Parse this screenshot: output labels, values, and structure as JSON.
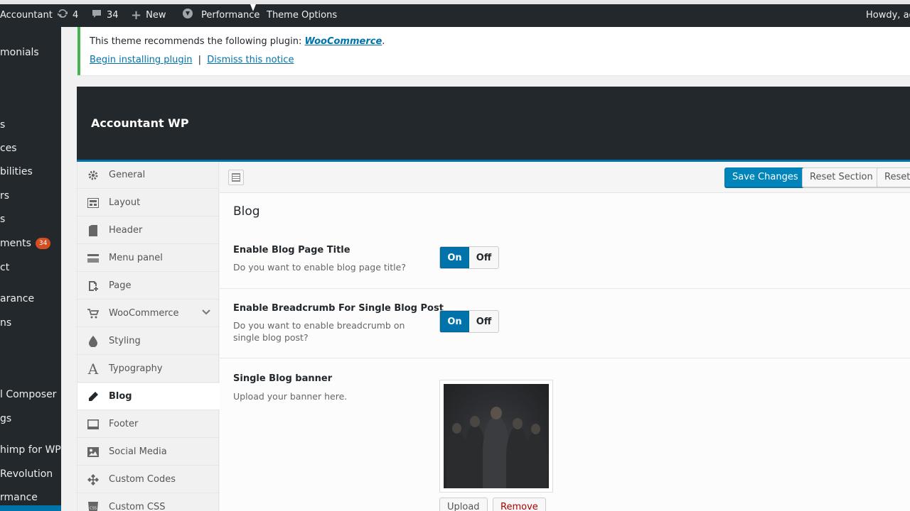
{
  "admin_bar": {
    "site_name": "Accountant",
    "updates_count": "4",
    "comments_count": "34",
    "new_label": "New",
    "performance_label": "Performance",
    "theme_options_label": "Theme Options",
    "howdy_label": "Howdy, ad"
  },
  "admin_menu": {
    "items": [
      {
        "label": "monials"
      },
      {
        "label": "s"
      },
      {
        "label": "ces"
      },
      {
        "label": "bilities"
      },
      {
        "label": "rs"
      },
      {
        "label": "s"
      },
      {
        "label": "ments",
        "badge": "34"
      },
      {
        "label": "ct"
      },
      {
        "label": "arance"
      },
      {
        "label": "ns"
      },
      {
        "label": "l Composer"
      },
      {
        "label": "gs"
      },
      {
        "label": "himp for WP"
      },
      {
        "label": " Revolution"
      },
      {
        "label": "rmance"
      }
    ]
  },
  "notice": {
    "text": "This theme recommends the following plugin: ",
    "plugin_name": "WooCommerce",
    "period": ".",
    "begin_link": "Begin installing plugin",
    "separator": "|",
    "dismiss_link": "Dismiss this notice"
  },
  "panel": {
    "title": "Accountant WP"
  },
  "sidebar": {
    "items": [
      {
        "label": "General",
        "icon": "gear-icon"
      },
      {
        "label": "Layout",
        "icon": "layout-icon"
      },
      {
        "label": "Header",
        "icon": "header-icon"
      },
      {
        "label": "Menu panel",
        "icon": "menu-panel-icon"
      },
      {
        "label": "Page",
        "icon": "page-icon"
      },
      {
        "label": "WooCommerce",
        "icon": "cart-icon"
      },
      {
        "label": "Styling",
        "icon": "droplet-icon"
      },
      {
        "label": "Typography",
        "icon": "typography-icon"
      },
      {
        "label": "Blog",
        "icon": "pencil-icon"
      },
      {
        "label": "Footer",
        "icon": "footer-icon"
      },
      {
        "label": "Social Media",
        "icon": "image-icon"
      },
      {
        "label": "Custom Codes",
        "icon": "puzzle-icon"
      },
      {
        "label": "Custom CSS",
        "icon": "css-icon"
      }
    ],
    "active": "Blog"
  },
  "toolbar": {
    "save_label": "Save Changes",
    "reset_section_label": "Reset Section",
    "reset_all_label": "Reset A"
  },
  "section": {
    "title": "Blog",
    "fields": [
      {
        "label": "Enable Blog Page Title",
        "desc": "Do you want to enable blog page title?",
        "on": "On",
        "off": "Off",
        "value": "On"
      },
      {
        "label": "Enable Breadcrumb For Single Blog Post",
        "desc": "Do you want to enable breadcrumb on single blog post?",
        "on": "On",
        "off": "Off",
        "value": "On"
      },
      {
        "label": "Single Blog banner",
        "desc": "Upload your banner here.",
        "upload": "Upload",
        "remove": "Remove"
      }
    ]
  },
  "colors": {
    "adminbar_bg": "#23282d",
    "accent": "#0073aa",
    "notice_border": "#46b450",
    "badge": "#d54e21"
  }
}
